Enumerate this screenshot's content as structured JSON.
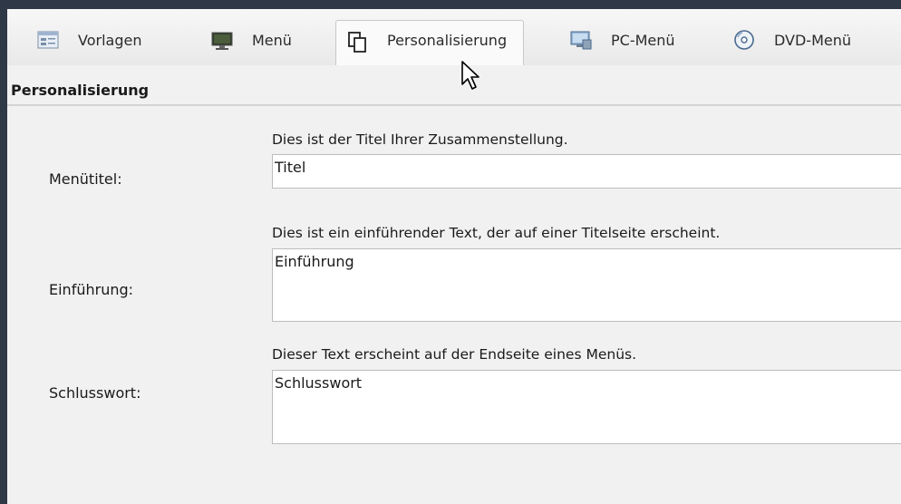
{
  "tabs": [
    {
      "label": "Vorlagen",
      "icon": "template-icon"
    },
    {
      "label": "Menü",
      "icon": "monitor-icon"
    },
    {
      "label": "Personalisierung",
      "icon": "copy-pages-icon",
      "active": true
    },
    {
      "label": "PC-Menü",
      "icon": "pc-monitor-icon"
    },
    {
      "label": "DVD-Menü",
      "icon": "dvd-disc-icon"
    }
  ],
  "section": {
    "title": "Personalisierung"
  },
  "fields": {
    "menutitel": {
      "label": "Menütitel:",
      "hint": "Dies ist der Titel Ihrer Zusammenstellung.",
      "value": "Titel"
    },
    "einfuehrung": {
      "label": "Einführung:",
      "hint": "Dies ist ein einführender Text, der auf einer Titelseite erscheint.",
      "value": "Einführung"
    },
    "schlusswort": {
      "label": "Schlusswort:",
      "hint": "Dieser Text erscheint auf der Endseite eines Menüs.",
      "value": "Schlusswort"
    }
  },
  "colors": {
    "frame": "#2f3846",
    "panel": "#f1f1f1",
    "field_bg": "#ffffff"
  }
}
